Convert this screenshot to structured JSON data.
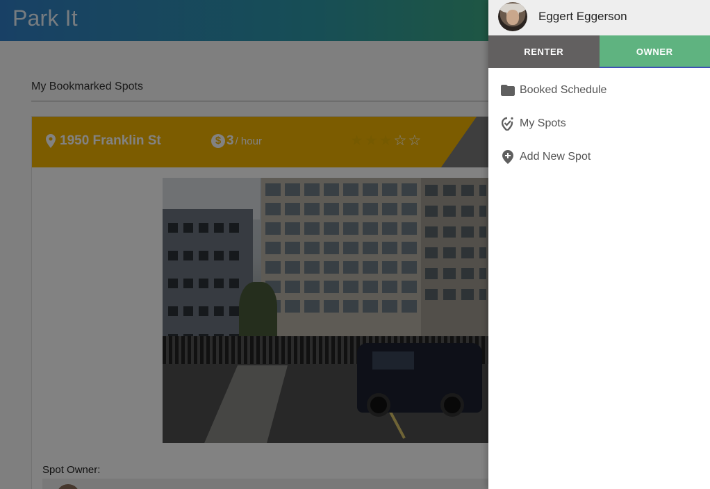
{
  "app": {
    "title": "Park It"
  },
  "bookmarks": {
    "section_title": "My Bookmarked Spots",
    "spot": {
      "address": "1950 Franklin St",
      "price_symbol": "$",
      "price": "3",
      "price_unit": "/ hour",
      "rating": 3,
      "rating_max": 5,
      "owner_label": "Spot Owner:"
    }
  },
  "drawer": {
    "user_name": "Eggert Eggerson",
    "tabs": [
      {
        "label": "RENTER",
        "active": false
      },
      {
        "label": "OWNER",
        "active": true
      }
    ],
    "menu": [
      {
        "label": "Booked Schedule",
        "icon": "folder-icon"
      },
      {
        "label": "My Spots",
        "icon": "location-check-icon"
      },
      {
        "label": "Add New Spot",
        "icon": "add-location-icon"
      }
    ]
  },
  "colors": {
    "header_gold": "#f4b400",
    "owner_tab": "#5fb380",
    "renter_tab": "#626060",
    "tab_indicator": "#3f51b5"
  }
}
